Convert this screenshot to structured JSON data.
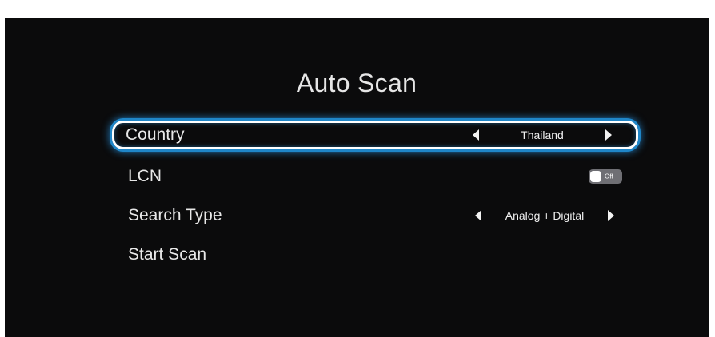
{
  "title": "Auto Scan",
  "colors": {
    "background": "#0b0b0c",
    "focus_border": "#ffffff",
    "focus_glow": "#1f86c8",
    "toggle_off": "#6f6f74"
  },
  "menu": {
    "country": {
      "label": "Country",
      "value": "Thailand",
      "focused": true
    },
    "lcn": {
      "label": "LCN",
      "toggle_state": "Off"
    },
    "search_type": {
      "label": "Search Type",
      "value": "Analog + Digital"
    },
    "start_scan": {
      "label": "Start Scan"
    }
  },
  "icons": {
    "previous": "triangle-left-icon",
    "next": "triangle-right-icon"
  }
}
